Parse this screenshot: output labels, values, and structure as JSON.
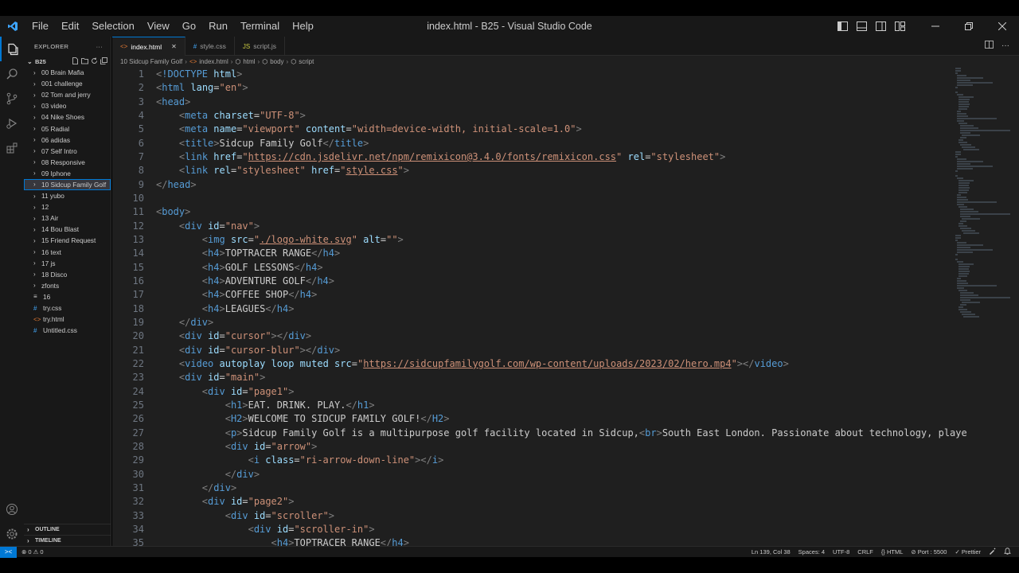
{
  "window": {
    "title": "index.html - B25 - Visual Studio Code",
    "menu": [
      "File",
      "Edit",
      "Selection",
      "View",
      "Go",
      "Run",
      "Terminal",
      "Help"
    ]
  },
  "sidebar": {
    "header": "EXPLORER",
    "more": "···",
    "folder": "B25",
    "items": [
      {
        "label": "00 Brain Mafia",
        "type": "folder"
      },
      {
        "label": "001 challenge",
        "type": "folder"
      },
      {
        "label": "02 Tom and jerry",
        "type": "folder"
      },
      {
        "label": "03 video",
        "type": "folder"
      },
      {
        "label": "04 Nike Shoes",
        "type": "folder"
      },
      {
        "label": "05 Radial",
        "type": "folder"
      },
      {
        "label": "06 adidas",
        "type": "folder"
      },
      {
        "label": "07 Self Intro",
        "type": "folder"
      },
      {
        "label": "08 Responsive",
        "type": "folder"
      },
      {
        "label": "09 Iphone",
        "type": "folder"
      },
      {
        "label": "10 Sidcup Family Golf",
        "type": "folder",
        "selected": true
      },
      {
        "label": "11 yubo",
        "type": "folder"
      },
      {
        "label": "12",
        "type": "folder"
      },
      {
        "label": "13 Air",
        "type": "folder"
      },
      {
        "label": "14 Bou Blast",
        "type": "folder"
      },
      {
        "label": "15 Friend Request",
        "type": "folder"
      },
      {
        "label": "16 text",
        "type": "folder"
      },
      {
        "label": "17 js",
        "type": "folder"
      },
      {
        "label": "18 Disco",
        "type": "folder"
      },
      {
        "label": "zfonts",
        "type": "folder"
      },
      {
        "label": "16",
        "type": "file-txt"
      },
      {
        "label": "try.css",
        "type": "file-css"
      },
      {
        "label": "try.html",
        "type": "file-html"
      },
      {
        "label": "Untitled.css",
        "type": "file-css"
      }
    ],
    "outline": "OUTLINE",
    "timeline": "TIMELINE"
  },
  "tabs": [
    {
      "label": "index.html",
      "icon": "html",
      "active": true
    },
    {
      "label": "style.css",
      "icon": "css",
      "active": false
    },
    {
      "label": "script.js",
      "icon": "js",
      "active": false
    }
  ],
  "breadcrumb": [
    "10 Sidcup Family Golf",
    "index.html",
    "html",
    "body",
    "script"
  ],
  "editor": {
    "line_numbers": [
      "1",
      "2",
      "3",
      "4",
      "5",
      "6",
      "7",
      "8",
      "9",
      "10",
      "11",
      "12",
      "13",
      "14",
      "15",
      "16",
      "17",
      "18",
      "19",
      "20",
      "21",
      "22",
      "23",
      "24",
      "25",
      "26",
      "27",
      "28",
      "29",
      "30",
      "31",
      "32",
      "33",
      "34",
      "35"
    ],
    "code_lines": [
      "<!DOCTYPE html>",
      "<html lang=\"en\">",
      "<head>",
      "    <meta charset=\"UTF-8\">",
      "    <meta name=\"viewport\" content=\"width=device-width, initial-scale=1.0\">",
      "    <title>Sidcup Family Golf</title>",
      "    <link href=\"https://cdn.jsdelivr.net/npm/remixicon@3.4.0/fonts/remixicon.css\" rel=\"stylesheet\">",
      "    <link rel=\"stylesheet\" href=\"style.css\">",
      "</head>",
      "",
      "<body>",
      "    <div id=\"nav\">",
      "        <img src=\"./logo-white.svg\" alt=\"\">",
      "        <h4>TOPTRACER RANGE</h4>",
      "        <h4>GOLF LESSONS</h4>",
      "        <h4>ADVENTURE GOLF</h4>",
      "        <h4>COFFEE SHOP</h4>",
      "        <h4>LEAGUES</h4>",
      "    </div>",
      "    <div id=\"cursor\"></div>",
      "    <div id=\"cursor-blur\"></div>",
      "    <video autoplay loop muted src=\"https://sidcupfamilygolf.com/wp-content/uploads/2023/02/hero.mp4\"></video>",
      "    <div id=\"main\">",
      "        <div id=\"page1\">",
      "            <h1>EAT. DRINK. PLAY.</h1>",
      "            <H2>WELCOME TO SIDCUP FAMILY GOLF!</H2>",
      "            <p>Sidcup Family Golf is a multipurpose golf facility located in Sidcup,<br>South East London. Passionate about technology, playe",
      "            <div id=\"arrow\">",
      "                <i class=\"ri-arrow-down-line\"></i>",
      "            </div>",
      "        </div>",
      "        <div id=\"page2\">",
      "            <div id=\"scroller\">",
      "                <div id=\"scroller-in\">",
      "                    <h4>TOPTRACER RANGE</h4>"
    ]
  },
  "statusbar": {
    "remote": "><",
    "problems": "⊗ 0 ⚠ 0",
    "position": "Ln 139, Col 38",
    "spaces": "Spaces: 4",
    "encoding": "UTF-8",
    "eol": "CRLF",
    "language": "{} HTML",
    "port": "⊘ Port : 5500",
    "prettier": "✓ Prettier"
  },
  "colors": {
    "accent": "#0078d4",
    "tag": "#569cd6",
    "attribute": "#9cdcfe",
    "string": "#ce9178",
    "editor_bg": "#1f1f1f",
    "chrome_bg": "#181818"
  }
}
